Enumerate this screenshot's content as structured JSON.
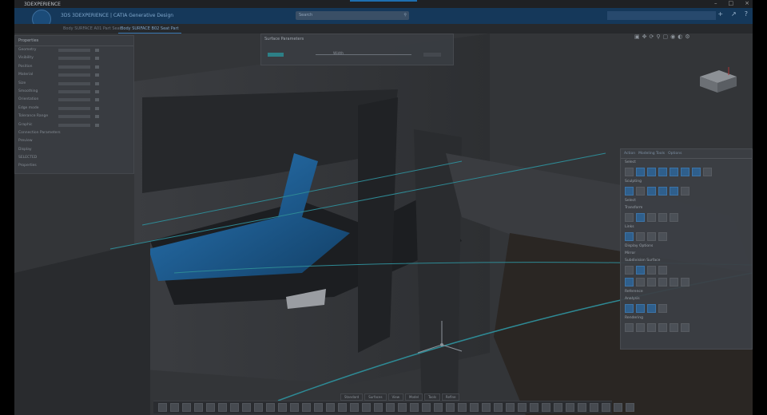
{
  "window": {
    "title": "3DEXPERIENCE",
    "controls": [
      "–",
      "□",
      "×"
    ]
  },
  "header": {
    "brand": "3DS  3DEXPERIENCE | CATIA  Generative Design",
    "search_placeholder": "Search",
    "icons": [
      "add-icon",
      "share-icon",
      "help-icon"
    ]
  },
  "tabs": [
    {
      "label": "Body SURFACE A01 Part Seat"
    },
    {
      "label": "Body SURFACE B02 Seat Part",
      "active": true
    }
  ],
  "left_panel": {
    "title": "Properties",
    "rows": [
      "Geometry",
      "Visibility",
      "Position",
      "Material",
      "Size",
      "Smoothing",
      "Orientation",
      "Edge mode",
      "Tolerance Range",
      "Graphic",
      "Connection Parameters",
      "Preview",
      "Display",
      "SELECTED",
      "Properties"
    ]
  },
  "mid_panel": {
    "title": "Surface Parameters",
    "value_label": "Width"
  },
  "right_panel": {
    "tabs": [
      "Action",
      "Modeling Tools",
      "Options"
    ],
    "sections": [
      "Select",
      "Sculpting",
      "Select",
      "Transform",
      "Links",
      "Display Options",
      "Mirror",
      "Subdivision Surface",
      "Reference",
      "Analysis",
      "Rendering"
    ]
  },
  "bottom_tabs": [
    "Standard",
    "Surfaces",
    "View",
    "Model",
    "Tools",
    "Refine"
  ],
  "colors": {
    "accent": "#1e6fb0",
    "topbar": "#15385a",
    "viewport_bg": "#2f3134",
    "seat_blue": "#1b5f95"
  }
}
